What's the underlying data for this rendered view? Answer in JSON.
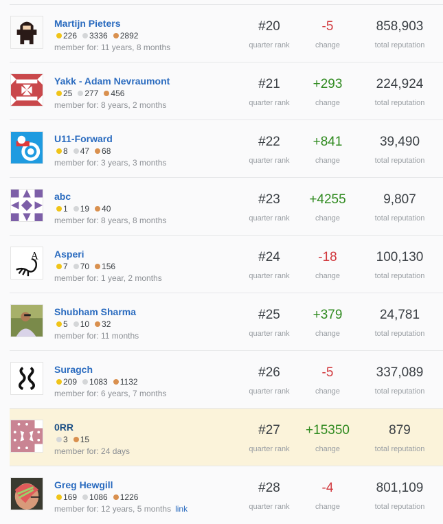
{
  "labels": {
    "rank": "quarter rank",
    "change": "change",
    "reputation": "total reputation",
    "member_prefix": "member for: "
  },
  "users": [
    {
      "name": "Martijn Pieters",
      "gold": "226",
      "silver": "3336",
      "bronze": "2892",
      "member": "member for: 11 years, 8 months",
      "rank": "#20",
      "change": "-5",
      "rep": "858,903",
      "avatar": "ninja"
    },
    {
      "name": "Yakk - Adam Nevraumont",
      "gold": "25",
      "silver": "277",
      "bronze": "456",
      "member": "member for: 8 years, 2 months",
      "rank": "#21",
      "change": "+293",
      "rep": "224,924",
      "avatar": "identicon-red"
    },
    {
      "name": "U11-Forward",
      "gold": "8",
      "silver": "47",
      "bronze": "68",
      "member": "member for: 3 years, 3 months",
      "rank": "#22",
      "change": "+841",
      "rep": "39,490",
      "avatar": "blue-cartoon"
    },
    {
      "name": "abc",
      "gold": "1",
      "silver": "19",
      "bronze": "40",
      "member": "member for: 8 years, 8 months",
      "rank": "#23",
      "change": "+4255",
      "rep": "9,807",
      "avatar": "identicon-purple"
    },
    {
      "name": "Asperi",
      "gold": "7",
      "silver": "70",
      "bronze": "156",
      "member": "member for: 1 year, 2 months",
      "rank": "#24",
      "change": "-18",
      "rep": "100,130",
      "avatar": "scorpion"
    },
    {
      "name": "Shubham Sharma",
      "gold": "5",
      "silver": "10",
      "bronze": "32",
      "member": "member for: 11 months",
      "rank": "#25",
      "change": "+379",
      "rep": "24,781",
      "avatar": "photo"
    },
    {
      "name": "Suragch",
      "gold": "209",
      "silver": "1083",
      "bronze": "1132",
      "member": "member for: 6 years, 7 months",
      "rank": "#26",
      "change": "-5",
      "rep": "337,089",
      "avatar": "script"
    },
    {
      "name": "0RR",
      "gold": null,
      "silver": "3",
      "bronze": "15",
      "member": "member for: 24 days",
      "rank": "#27",
      "change": "+15350",
      "rep": "879",
      "avatar": "identicon-pink",
      "highlight": true
    },
    {
      "name": "Greg Hewgill",
      "gold": "169",
      "silver": "1086",
      "bronze": "1226",
      "member": "member for: 12 years, 5 months",
      "link": "link",
      "rank": "#28",
      "change": "-4",
      "rep": "801,109",
      "avatar": "photo-hair"
    }
  ],
  "colors": {
    "link": "#2a6bbf",
    "negative": "#d1383d",
    "positive": "#2f8a1f",
    "highlight": "#fbf3da"
  }
}
